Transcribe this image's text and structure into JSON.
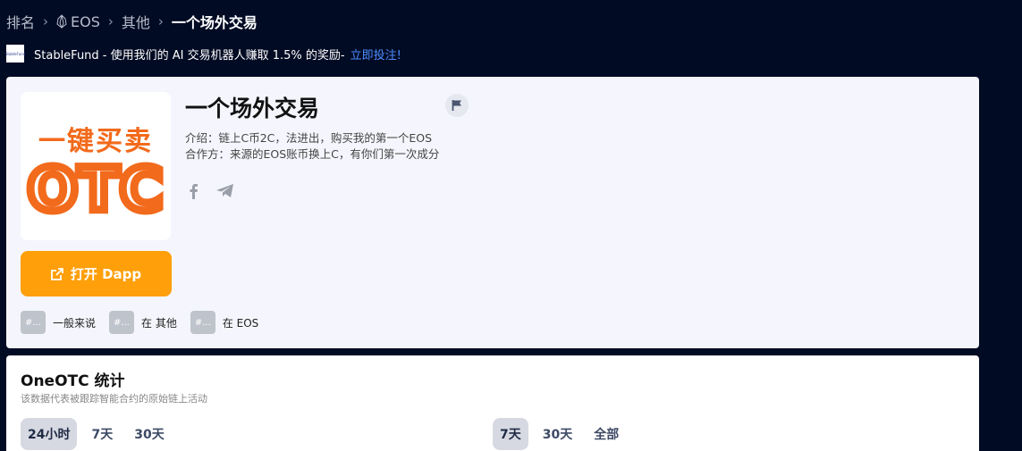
{
  "breadcrumb": {
    "items": [
      "排名",
      "EOS",
      "其他"
    ],
    "current": "一个场外交易"
  },
  "promo": {
    "logo_text": "StableFund",
    "text": "StableFund - 使用我们的 AI 交易机器人赚取 1.5% 的奖励-",
    "link": "立即投注!"
  },
  "app": {
    "logo_top_text": "一键买卖",
    "logo_bottom_text": "OTC",
    "title": "一个场外交易",
    "intro": "介绍：链上C币2C，法进出，购买我的第一个EOS",
    "partner": "合作方：来源的EOS账币换上C，有你们第一次成分",
    "open_button": "打开 Dapp",
    "tags": [
      {
        "hash": "#...",
        "label": "一般来说"
      },
      {
        "hash": "#...",
        "label": "在 其他"
      },
      {
        "hash": "#...",
        "label": "在 EOS"
      }
    ]
  },
  "stats": {
    "title": "OneOTC 统计",
    "subtitle": "该数据代表被跟踪智能合约的原始链上活动",
    "range_left": [
      "24小时",
      "7天",
      "30天"
    ],
    "range_right": [
      "7天",
      "30天",
      "全部"
    ]
  },
  "colors": {
    "background": "#020b24",
    "accent": "#ff9f0a",
    "link": "#4c8dff",
    "logo_orange": "#f26a1b"
  }
}
